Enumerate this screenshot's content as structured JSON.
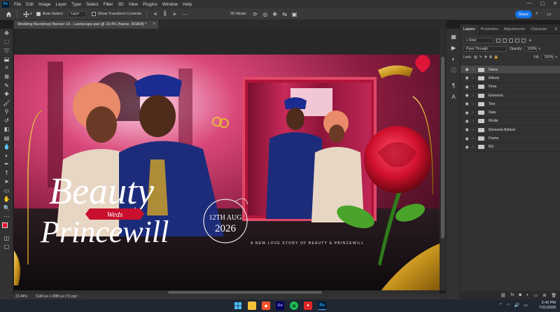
{
  "app": {
    "logo": "Ps"
  },
  "menu": [
    "File",
    "Edit",
    "Image",
    "Layer",
    "Type",
    "Select",
    "Filter",
    "3D",
    "View",
    "Plugins",
    "Window",
    "Help"
  ],
  "window_controls": [
    "—",
    "▢",
    "✕"
  ],
  "options": {
    "auto_select_label": "Auto-Select:",
    "auto_select_target": "Layer",
    "transform_label": "Show Transform Controls",
    "mode3d_label": "3D Mode:",
    "share_label": "Share"
  },
  "document": {
    "tab_title": "Wedding Backdrop( Banner 10 - Landscape.psd @ 23.4% (Name, RGB/8) *",
    "close": "×"
  },
  "artwork": {
    "title_line1": "Beauty",
    "ribbon_text": "Weds",
    "title_line2": "Princewill",
    "date_line1": "12TH AUG",
    "date_line2": "2026",
    "tagline": "A NEW LOVE STORY OF BEAUTY & PRINCEWILL"
  },
  "status": {
    "zoom": "23.44%",
    "doc_size": "5184 px x 2880 px (72 ppi)"
  },
  "panel": {
    "tabs": [
      "Layers",
      "Properties",
      "Adjustments",
      "Character"
    ],
    "kind_label": "Kind",
    "blend_mode": "Pass Through",
    "opacity_label": "Opacity:",
    "opacity_value": "100%",
    "lock_label": "Lock:",
    "fill_label": "Fill:",
    "fill_value": "100%",
    "layers": [
      {
        "name": "Name"
      },
      {
        "name": "Effects"
      },
      {
        "name": "Flora"
      },
      {
        "name": "Elements"
      },
      {
        "name": "Text"
      },
      {
        "name": "Date"
      },
      {
        "name": "Model"
      },
      {
        "name": "Elements Behind"
      },
      {
        "name": "Frame"
      },
      {
        "name": "BG"
      }
    ]
  },
  "taskbar": {
    "time": "3:42 PM",
    "date": "7/11/2026",
    "apps": [
      "windows-start",
      "file-explorer",
      "brave-browser",
      "after-effects",
      "spotify",
      "screen-recorder",
      "photoshop"
    ]
  },
  "colors": {
    "accent_blue": "#1473e6",
    "ribbon_red": "#c8102e",
    "panel_bg": "#323232",
    "app_bg": "#1e1e1e"
  }
}
